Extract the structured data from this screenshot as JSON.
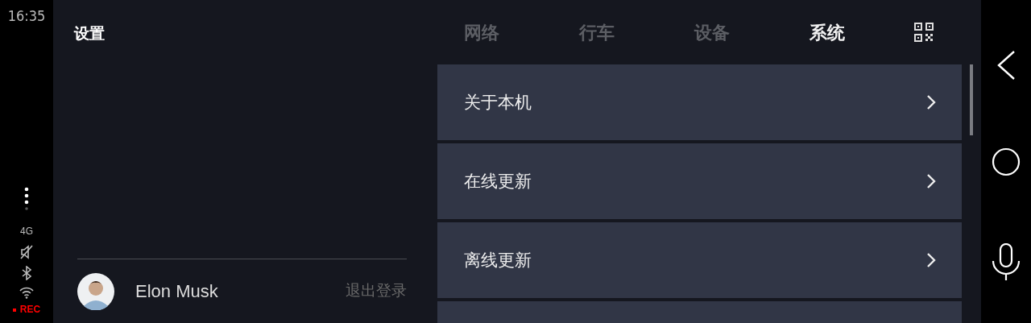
{
  "status_bar": {
    "time": "16:35",
    "network": "4G",
    "recording": "REC"
  },
  "title": "设置",
  "user": {
    "name": "Elon Musk",
    "logout": "退出登录"
  },
  "tabs": [
    {
      "label": "网络",
      "selected": false
    },
    {
      "label": "行车",
      "selected": false
    },
    {
      "label": "设备",
      "selected": false
    },
    {
      "label": "系统",
      "selected": true
    }
  ],
  "items": [
    {
      "label": "关于本机"
    },
    {
      "label": "在线更新"
    },
    {
      "label": "离线更新"
    }
  ]
}
